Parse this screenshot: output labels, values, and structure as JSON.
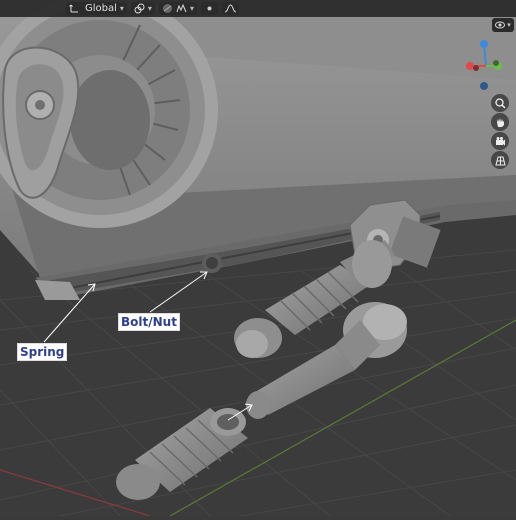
{
  "header": {
    "orientation_label": "Global",
    "orientation_icon": "transform-orientation-icon",
    "pivot_icon": "pivot-point-icon",
    "snap_icon": "snap-icon",
    "proportional_icon": "proportional-editing-icon",
    "falloff_icon": "falloff-curve-icon"
  },
  "viewport": {
    "overlays_icon": "eye-icon",
    "navigation": [
      "zoom-icon",
      "hand-icon",
      "camera-icon",
      "grid-icon"
    ]
  },
  "gizmo": {
    "x_color": "#e04a4a",
    "y_color": "#6cc04a",
    "z_color": "#3a8ae0"
  },
  "annotations": {
    "bolt_nut": "Bolt/Nut",
    "spring": "Spring"
  },
  "colors": {
    "model_fill": "#8a8a8a",
    "background": "#3a3a3a",
    "label_text": "#2d3f8e"
  }
}
